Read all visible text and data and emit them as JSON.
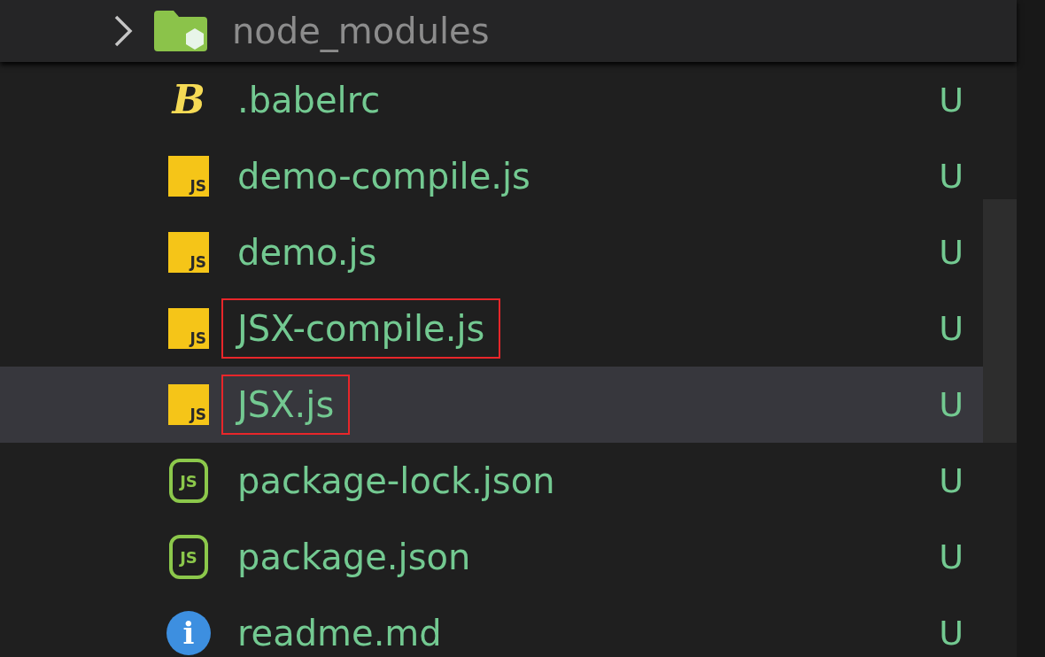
{
  "folder": {
    "name": "node_modules",
    "expanded": false
  },
  "files": [
    {
      "name": ".babelrc",
      "kind": "babel",
      "icon_text": "B",
      "status": "U",
      "selected": false,
      "highlighted": false
    },
    {
      "name": "demo-compile.js",
      "kind": "js",
      "icon_text": "JS",
      "status": "U",
      "selected": false,
      "highlighted": false
    },
    {
      "name": "demo.js",
      "kind": "js",
      "icon_text": "JS",
      "status": "U",
      "selected": false,
      "highlighted": false
    },
    {
      "name": "JSX-compile.js",
      "kind": "js",
      "icon_text": "JS",
      "status": "U",
      "selected": false,
      "highlighted": true
    },
    {
      "name": "JSX.js",
      "kind": "js",
      "icon_text": "JS",
      "status": "U",
      "selected": true,
      "highlighted": true
    },
    {
      "name": "package-lock.json",
      "kind": "json",
      "icon_text": "JS",
      "status": "U",
      "selected": false,
      "highlighted": false
    },
    {
      "name": "package.json",
      "kind": "json",
      "icon_text": "JS",
      "status": "U",
      "selected": false,
      "highlighted": false
    },
    {
      "name": "readme.md",
      "kind": "info",
      "icon_text": "i",
      "status": "U",
      "selected": false,
      "highlighted": false
    }
  ]
}
